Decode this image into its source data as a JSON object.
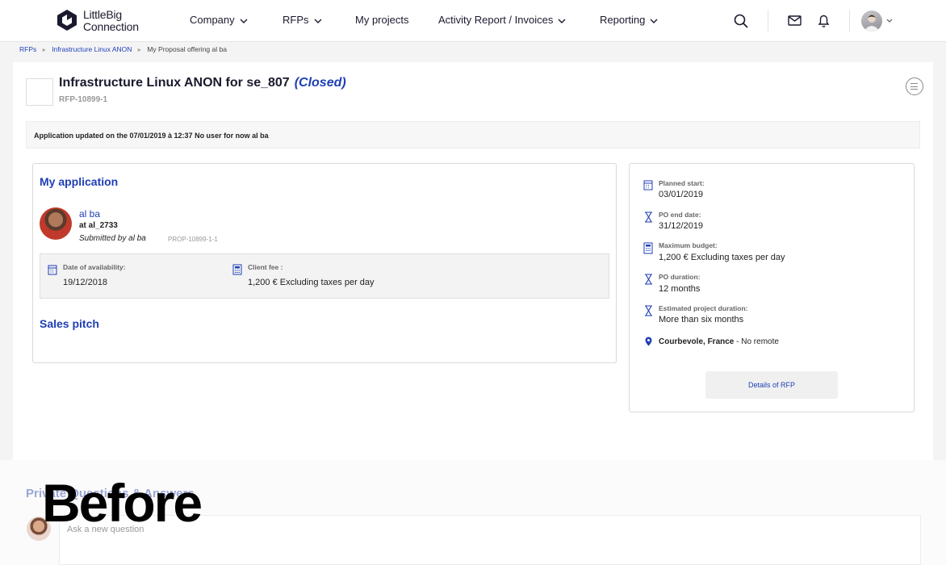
{
  "brand": {
    "line1": "LittleBig",
    "line2": "Connection"
  },
  "nav": {
    "company": "Company",
    "rfps": "RFPs",
    "my_projects": "My projects",
    "activity": "Activity Report / Invoices",
    "reporting": "Reporting"
  },
  "icons": [
    "logo-icon",
    "search-icon",
    "mail-icon",
    "bell-icon",
    "chevron-down-icon",
    "menu-lines-icon",
    "calendar-icon",
    "hourglass-icon",
    "calculator-icon",
    "location-pin-icon"
  ],
  "colors": {
    "accent": "#1f3fb5",
    "title": "#1a1a2e"
  },
  "breadcrumb": {
    "rfps": "RFPs",
    "rfp": "Infrastructure Linux ANON",
    "current": "My Proposal offering al ba"
  },
  "header": {
    "title": "Infrastructure Linux ANON for se_807",
    "status": "(Closed)",
    "ref": "RFP-10899-1"
  },
  "banner": "Application updated on the 07/01/2019 à 12:37 No user for now al ba",
  "application": {
    "heading": "My application",
    "name": "al ba",
    "at": "at al_2733",
    "submitted": "Submitted by al ba",
    "prop_ref": "PROP-10899-1-1",
    "availability_label": "Date of availability:",
    "availability_value": "19/12/2018",
    "fee_label": "Client fee :",
    "fee_value": "1,200 € Excluding taxes per day",
    "sales_pitch": "Sales pitch"
  },
  "info": {
    "planned_start_label": "Planned start:",
    "planned_start": "03/01/2019",
    "po_end_label": "PO end date:",
    "po_end": "31/12/2019",
    "max_budget_label": "Maximum budget:",
    "max_budget": "1,200 € Excluding taxes per day",
    "po_duration_label": "PO duration:",
    "po_duration": "12 months",
    "est_duration_label": "Estimated project duration:",
    "est_duration": "More than six months",
    "location": "Courbevole, France",
    "remote": " - No remote",
    "details_button": "Details of RFP"
  },
  "questions": {
    "heading": "Private Questions & Answers",
    "placeholder": "Ask a new question"
  },
  "overlay": "Before"
}
